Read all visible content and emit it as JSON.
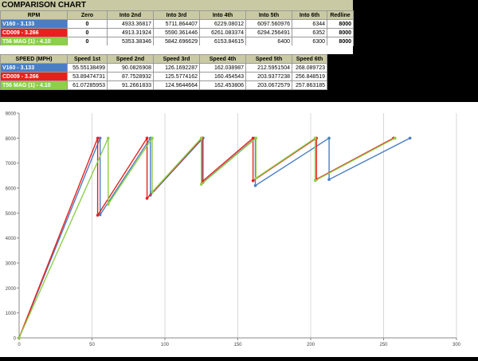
{
  "title": "COMPARISON CHART",
  "rpm_table": {
    "headers": [
      "RPM",
      "Zero",
      "Into 2nd",
      "Into 3rd",
      "Into 4th",
      "Into 5th",
      "Into 6th",
      "Redline"
    ],
    "rows": [
      {
        "label": "V160 - 3.133",
        "color": "#4a7ec4",
        "values": [
          "0",
          "4933.36817",
          "5711.864407",
          "6229.08012",
          "6097.560976",
          "6344",
          "8000"
        ]
      },
      {
        "label": "CD009 - 3.266",
        "color": "#e8201c",
        "values": [
          "0",
          "4913.31924",
          "5590.361446",
          "6261.083374",
          "6294.256491",
          "6352",
          "8000"
        ]
      },
      {
        "label": "T56 MAG (1) - 4.10",
        "color": "#8dcf4a",
        "values": [
          "0",
          "5353.38346",
          "5842.696629",
          "6153.84615",
          "6400",
          "6300",
          "8000"
        ]
      }
    ]
  },
  "speed_table": {
    "headers": [
      "SPEED (MPH)",
      "Speed 1st",
      "Speed 2nd",
      "Speed 3rd",
      "Speed 4th",
      "Speed 5th",
      "Speed 6th"
    ],
    "rows": [
      {
        "label": "V160 - 3.133",
        "color": "#4a7ec4",
        "values": [
          "55.55138499",
          "90.0826908",
          "126.1692287",
          "162.038987",
          "212.5951504",
          "268.089723"
        ]
      },
      {
        "label": "CD009 - 3.266",
        "color": "#e8201c",
        "values": [
          "53.89474731",
          "87.7528932",
          "125.5774162",
          "160.454543",
          "203.9377238",
          "256.848519"
        ]
      },
      {
        "label": "T56 MAG (1) - 4.10",
        "color": "#8dcf4a",
        "values": [
          "61.07285953",
          "91.2661833",
          "124.9644664",
          "162.453806",
          "203.0672579",
          "257.863185"
        ]
      }
    ]
  },
  "chart_data": {
    "type": "line",
    "title": "",
    "xlabel": "",
    "ylabel": "",
    "xlim": [
      0,
      300
    ],
    "ylim": [
      0,
      9000
    ],
    "xticks": [
      "0",
      "50",
      "100",
      "150",
      "200",
      "250",
      "300"
    ],
    "yticks": [
      "0",
      "1000",
      "2000",
      "3000",
      "4000",
      "5000",
      "6000",
      "7000",
      "8000",
      "9000"
    ],
    "grid": "vertical",
    "series": [
      {
        "name": "V160 - 3.133",
        "color": "#4a7ec4",
        "x": [
          0,
          55.55,
          55.55,
          90.08,
          90.08,
          126.17,
          126.17,
          162.04,
          162.04,
          212.6,
          212.6,
          268.09
        ],
        "y": [
          0,
          8000,
          4933,
          8000,
          5712,
          8000,
          6229,
          8000,
          6098,
          8000,
          6344,
          8000
        ]
      },
      {
        "name": "CD009 - 3.266",
        "color": "#e8201c",
        "x": [
          0,
          53.89,
          53.89,
          87.75,
          87.75,
          125.58,
          125.58,
          160.45,
          160.45,
          203.94,
          203.94,
          256.85
        ],
        "y": [
          0,
          8000,
          4913,
          8000,
          5590,
          8000,
          6261,
          8000,
          6294,
          8000,
          6352,
          8000
        ]
      },
      {
        "name": "T56 MAG (1) - 4.10",
        "color": "#8dcf4a",
        "x": [
          0,
          61.07,
          61.07,
          91.27,
          91.27,
          124.96,
          124.96,
          162.45,
          162.45,
          203.07,
          203.07,
          257.86
        ],
        "y": [
          0,
          8000,
          5353,
          8000,
          5843,
          8000,
          6154,
          8000,
          6400,
          8000,
          6300,
          8000
        ]
      }
    ]
  }
}
